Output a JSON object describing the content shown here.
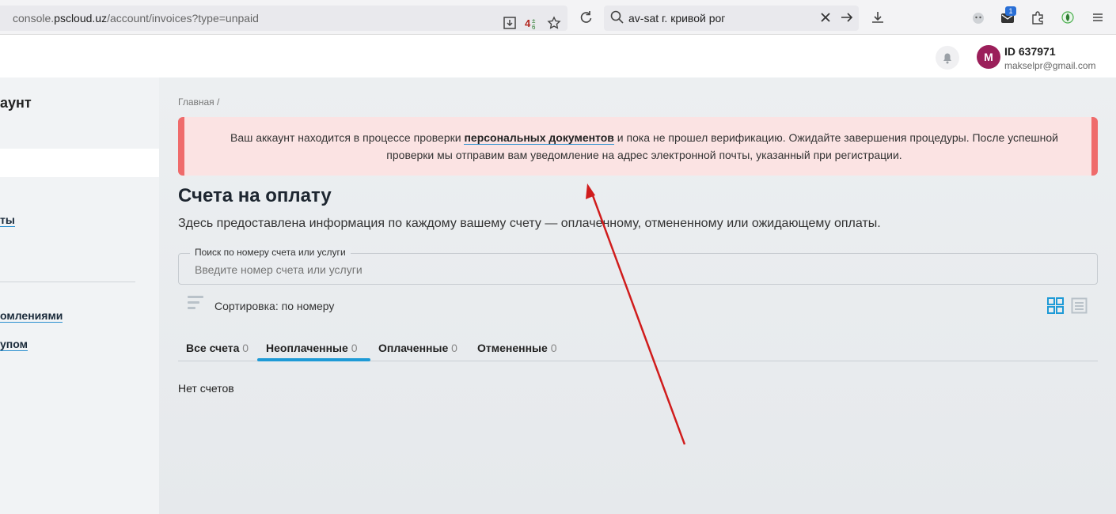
{
  "browser": {
    "url_prefix": "console.",
    "url_domain": "pscloud.uz",
    "url_path": "/account/invoices?type=unpaid",
    "search_query": "av-sat г. кривой рог",
    "extension_badge": "1"
  },
  "header": {
    "avatar_letter": "M",
    "user_id": "ID 637971",
    "user_email": "makselpr@gmail.com"
  },
  "sidebar": {
    "title": "аунт",
    "links": [
      {
        "label": "ты"
      },
      {
        "label": "омлениями"
      },
      {
        "label": "упом"
      }
    ]
  },
  "main": {
    "breadcrumb": "Главная  /",
    "alert": {
      "before": "Ваш аккаунт находится в процессе проверки ",
      "link": "персональных документов",
      "after": " и пока не прошел верификацию. Ожидайте завершения процедуры. После успешной проверки мы отправим вам уведомление на адрес электронной почты, указанный при регистрации."
    },
    "title": "Счета на оплату",
    "description": "Здесь предоставлена информация по каждому вашему счету — оплаченному, отмененному или ожидающему оплаты.",
    "search": {
      "legend": "Поиск по номеру счета или услуги",
      "placeholder": "Введите номер счета или услуги"
    },
    "sort_label": "Сортировка: по номеру",
    "tabs": [
      {
        "label": "Все счета",
        "count": "0"
      },
      {
        "label": "Неоплаченные",
        "count": "0",
        "active": true
      },
      {
        "label": "Оплаченные",
        "count": "0"
      },
      {
        "label": "Отмененные",
        "count": "0"
      }
    ],
    "empty_text": "Нет счетов"
  },
  "colors": {
    "alert_bg": "#fbe3e3",
    "alert_border": "#ef6b6b",
    "accent": "#1e9ad6",
    "avatar": "#9b1f5a",
    "annotation_arrow": "#d01c1c"
  },
  "icons": [
    "download-page-icon",
    "translate-icon",
    "star-icon",
    "reload-icon",
    "search-icon",
    "clear-icon",
    "go-arrow-icon",
    "downloads-icon",
    "extension-icons",
    "bell-icon",
    "sort-icon",
    "grid-view-icon",
    "list-view-icon"
  ]
}
